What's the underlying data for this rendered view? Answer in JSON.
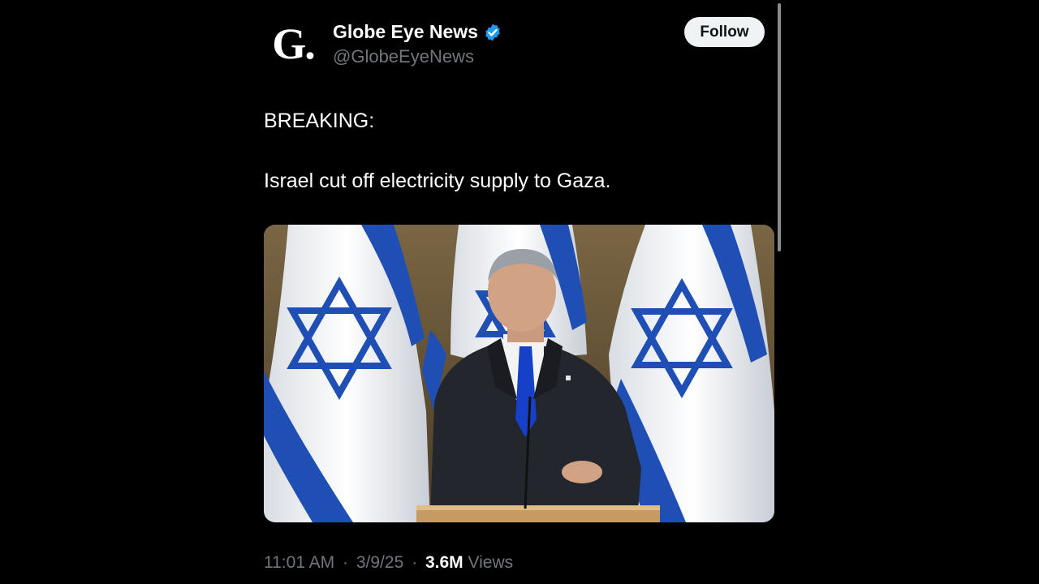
{
  "post": {
    "author": {
      "display_name": "Globe Eye News",
      "handle": "@GlobeEyeNews",
      "avatar_letter": "G.",
      "verified": true
    },
    "follow_label": "Follow",
    "text_lines": [
      "BREAKING:",
      "Israel cut off electricity supply to Gaza."
    ],
    "media": {
      "type": "photo"
    },
    "meta": {
      "time": "11:01 AM",
      "date": "3/9/25",
      "separator": "·",
      "views_count": "3.6M",
      "views_label": "Views"
    }
  },
  "colors": {
    "background": "#000000",
    "verified_blue": "#1d9bf0",
    "flag_blue": "#1f4fb5",
    "muted_text": "#71767b",
    "follow_button_bg": "#eff3f4"
  },
  "icons": {
    "verified": "verified-badge-icon"
  }
}
